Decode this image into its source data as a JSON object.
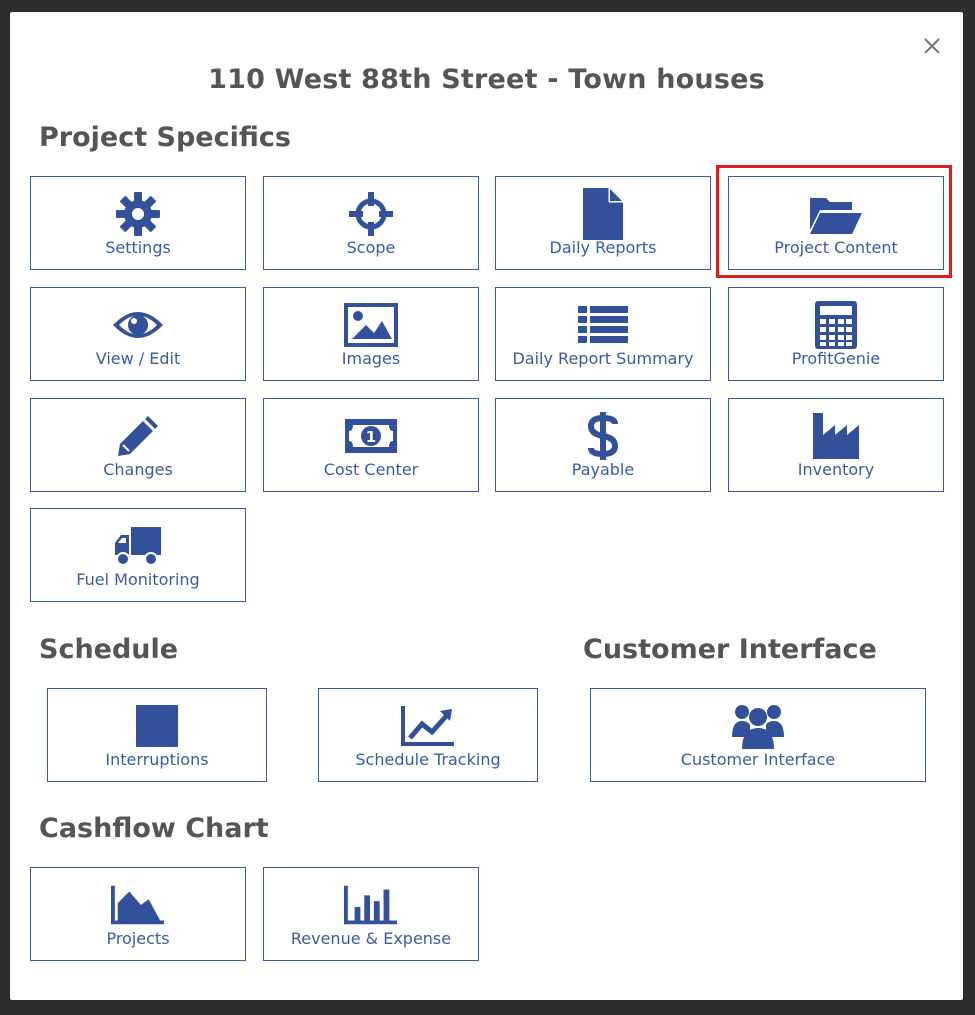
{
  "dialog": {
    "title": "110 West 88th Street - Town houses",
    "close_icon": "close-icon"
  },
  "colors": {
    "accent": "#3a5aa5",
    "heading": "#555555",
    "highlight": "#e11b1b"
  },
  "sections": {
    "project_specifics": {
      "title": "Project Specifics",
      "tiles": [
        {
          "label": "Settings",
          "icon": "gear-icon"
        },
        {
          "label": "Scope",
          "icon": "crosshair-icon"
        },
        {
          "label": "Daily Reports",
          "icon": "document-icon"
        },
        {
          "label": "Project Content",
          "icon": "folder-open-icon",
          "highlighted": true
        },
        {
          "label": "View / Edit",
          "icon": "eye-icon"
        },
        {
          "label": "Images",
          "icon": "image-icon"
        },
        {
          "label": "Daily Report Summary",
          "icon": "list-icon"
        },
        {
          "label": "ProfitGenie",
          "icon": "calculator-icon"
        },
        {
          "label": "Changes",
          "icon": "pencil-icon"
        },
        {
          "label": "Cost Center",
          "icon": "money-icon"
        },
        {
          "label": "Payable",
          "icon": "dollar-icon"
        },
        {
          "label": "Inventory",
          "icon": "factory-icon"
        },
        {
          "label": "Fuel Monitoring",
          "icon": "truck-icon"
        }
      ]
    },
    "schedule": {
      "title": "Schedule",
      "tiles": [
        {
          "label": "Interruptions",
          "icon": "square-icon"
        },
        {
          "label": "Schedule Tracking",
          "icon": "line-chart-icon"
        }
      ]
    },
    "customer_interface": {
      "title": "Customer Interface",
      "tiles": [
        {
          "label": "Customer Interface",
          "icon": "users-icon"
        }
      ]
    },
    "cashflow_chart": {
      "title": "Cashflow Chart",
      "tiles": [
        {
          "label": "Projects",
          "icon": "area-chart-icon"
        },
        {
          "label": "Revenue & Expense",
          "icon": "bar-chart-icon"
        }
      ]
    }
  }
}
